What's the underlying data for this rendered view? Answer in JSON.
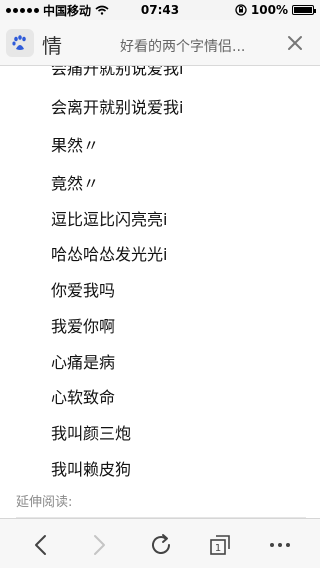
{
  "status_bar": {
    "carrier": "中国移动",
    "time": "07:43",
    "battery": "100%"
  },
  "header": {
    "title_char": "情",
    "title": "好看的两个字情侣..."
  },
  "items": [
    "会痛开就别说爱我i",
    "会离开就别说爱我i",
    "果然〃",
    "竟然〃",
    "逗比逗比闪亮亮i",
    "哈怂哈怂发光光i",
    "你爱我吗",
    "我爱你啊",
    "心痛是病",
    "心软致命",
    "我叫颜三炮",
    "我叫赖皮狗"
  ],
  "footer": {
    "label": "延伸阅读:"
  },
  "toolbar": {
    "tabs_count": "1"
  }
}
